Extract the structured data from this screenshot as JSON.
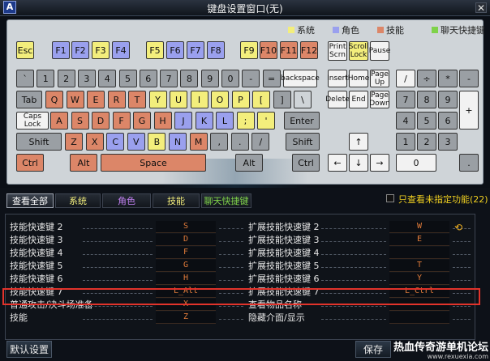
{
  "window": {
    "title": "键盘设置窗口(无)",
    "app_icon_letter": "A",
    "close_glyph": "✕"
  },
  "legend": [
    {
      "label": "系统",
      "color": "#f3ee7c"
    },
    {
      "label": "角色",
      "color": "#9aa0ee"
    },
    {
      "label": "技能",
      "color": "#dc8668"
    },
    {
      "label": "聊天快捷键",
      "color": "#7fd24a"
    }
  ],
  "colors": {
    "grey": "#9a9fa4",
    "red": "#dc8668",
    "blue": "#9aa0ee",
    "yellow": "#f3ee7c",
    "white": "#f2f2f2",
    "highlight": "#e2332b"
  },
  "keyboard": {
    "fn_row": [
      "Esc",
      "F1",
      "F2",
      "F3",
      "F4",
      "F5",
      "F6",
      "F7",
      "F8",
      "F9",
      "F10",
      "F11",
      "F12"
    ],
    "nav_top": [
      "Print\nScrn",
      "Scroll\nLock",
      "Pause"
    ],
    "number_row": [
      "`",
      "1",
      "2",
      "3",
      "4",
      "5",
      "6",
      "7",
      "8",
      "9",
      "0",
      "-",
      "=",
      "backspace"
    ],
    "nav_mid1": [
      "Insert",
      "Home",
      "Page\nUp"
    ],
    "numpad_row1": [
      "/",
      "÷",
      "*",
      "-"
    ],
    "qwerty_row": [
      "Tab",
      "Q",
      "W",
      "E",
      "R",
      "T",
      "Y",
      "U",
      "I",
      "O",
      "P",
      "[",
      "]",
      "\\"
    ],
    "nav_mid2": [
      "Delete",
      "End",
      "Page\nDown"
    ],
    "numpad_row2": [
      "7",
      "8",
      "9",
      "+"
    ],
    "asdf_row": [
      "Caps\nLock",
      "A",
      "S",
      "D",
      "F",
      "G",
      "H",
      "J",
      "K",
      "L",
      ";",
      "'",
      "Enter"
    ],
    "numpad_row3": [
      "4",
      "5",
      "6"
    ],
    "zxcv_row": [
      "Shift",
      "Z",
      "X",
      "C",
      "V",
      "B",
      "N",
      "M",
      ",",
      ".",
      "/",
      "Shift"
    ],
    "arrow_up": "↑",
    "numpad_row4": [
      "1",
      "2",
      "3"
    ],
    "bottom_row": [
      "Ctrl",
      "Alt",
      "Space",
      "Alt",
      "Ctrl"
    ],
    "arrows": [
      "←",
      "↓",
      "→"
    ],
    "numpad_row5": [
      "0",
      "."
    ]
  },
  "tabs": [
    {
      "label": "查看全部",
      "color": "#ffffff"
    },
    {
      "label": "系统",
      "color": "#f3ee7c"
    },
    {
      "label": "角色",
      "color": "#c080f0"
    },
    {
      "label": "技能",
      "color": "#f3ee7c"
    },
    {
      "label": "聊天快捷键",
      "color": "#7fd24a"
    }
  ],
  "filter_label": "只查看未指定功能(22)",
  "bindings_left": [
    {
      "name": "技能快速键 2",
      "key": "S"
    },
    {
      "name": "技能快速键 3",
      "key": "D"
    },
    {
      "name": "技能快速键 4",
      "key": "F"
    },
    {
      "name": "技能快速键 5",
      "key": "G"
    },
    {
      "name": "技能快速键 6",
      "key": "H"
    },
    {
      "name": "技能快速键 7",
      "key": "L_Alt"
    },
    {
      "name": "普通攻击/决斗场准备",
      "key": "X"
    },
    {
      "name": "技能",
      "key": "Z"
    }
  ],
  "bindings_right": [
    {
      "name": "扩展技能快速键 2",
      "key": "W"
    },
    {
      "name": "扩展技能快速键 3",
      "key": "E"
    },
    {
      "name": "扩展技能快速键 4",
      "key": ""
    },
    {
      "name": "扩展技能快速键 5",
      "key": "T"
    },
    {
      "name": "扩展技能快速键 6",
      "key": "Y"
    },
    {
      "name": "扩展技能快速键 7",
      "key": "L_Ctrl"
    },
    {
      "name": "查看物品名称",
      "key": ""
    },
    {
      "name": "隐藏介面/显示",
      "key": ""
    }
  ],
  "scroll_icon": "⟲",
  "buttons": {
    "reset": "默认设置",
    "save": "保存"
  },
  "watermark": {
    "line1": "热血传奇游单机论坛",
    "line2": "www.rexuexia.com"
  }
}
